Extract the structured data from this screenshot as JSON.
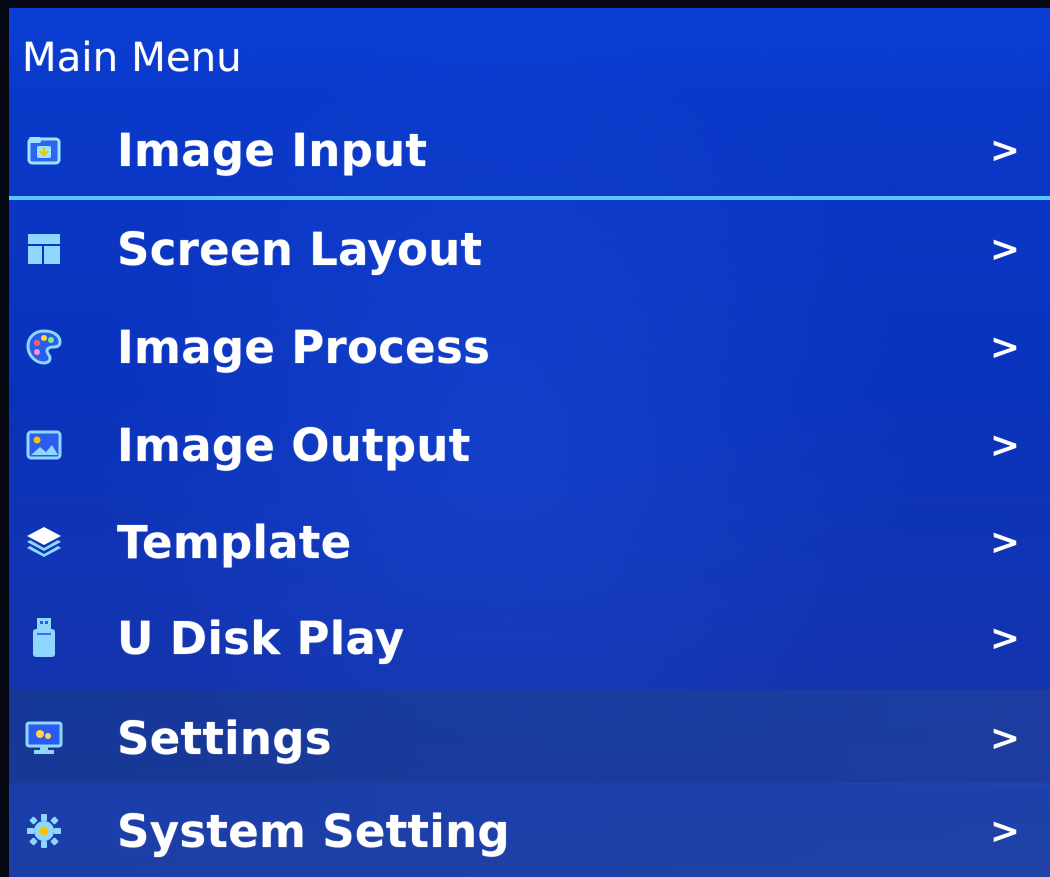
{
  "header": {
    "title": "Main Menu"
  },
  "menu": {
    "items": [
      {
        "label": "Image Input",
        "icon": "folder-input-icon",
        "chevron": ">"
      },
      {
        "label": "Screen Layout",
        "icon": "layout-icon",
        "chevron": ">"
      },
      {
        "label": "Image Process",
        "icon": "palette-icon",
        "chevron": ">"
      },
      {
        "label": "Image Output",
        "icon": "image-output-icon",
        "chevron": ">"
      },
      {
        "label": "Template",
        "icon": "layers-icon",
        "chevron": ">"
      },
      {
        "label": "U Disk Play",
        "icon": "usb-drive-icon",
        "chevron": ">"
      },
      {
        "label": "Settings",
        "icon": "monitor-settings-icon",
        "chevron": ">"
      },
      {
        "label": "System Setting",
        "icon": "gear-icon",
        "chevron": ">"
      }
    ]
  },
  "colors": {
    "background": "#0a38c8",
    "text": "#ffffff",
    "accent": "#59c8ff",
    "selection_line": "#59c8ff"
  }
}
